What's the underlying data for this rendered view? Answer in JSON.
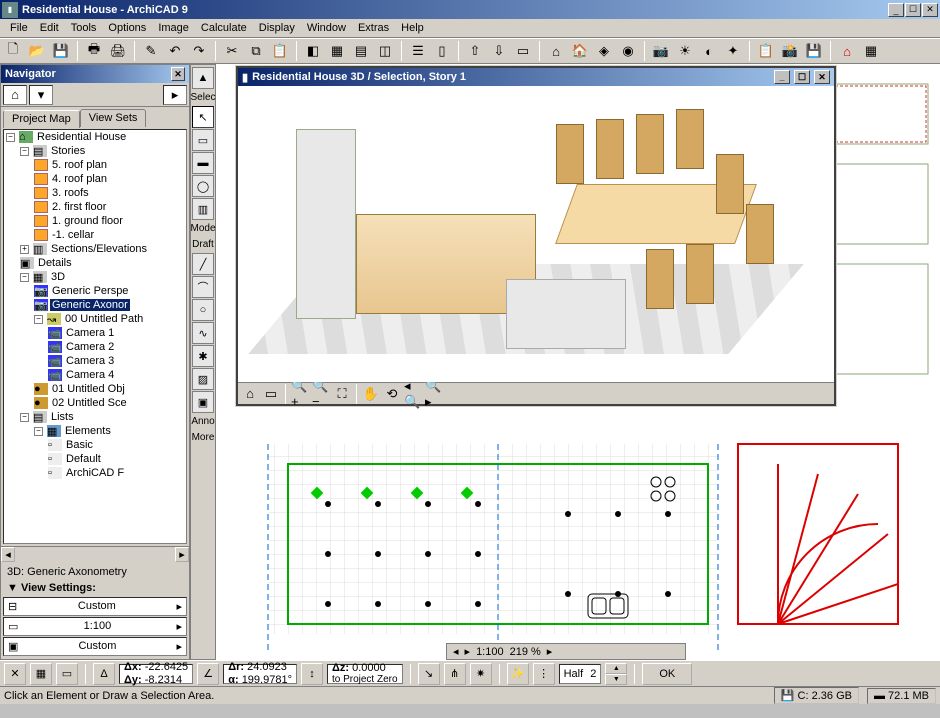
{
  "window": {
    "title": "Residential House - ArchiCAD 9",
    "min": "_",
    "max": "☐",
    "close": "✕"
  },
  "menu": [
    "File",
    "Edit",
    "Tools",
    "Options",
    "Image",
    "Calculate",
    "Display",
    "Window",
    "Extras",
    "Help"
  ],
  "navigator": {
    "title": "Navigator",
    "tabs": {
      "project_map": "Project Map",
      "view_sets": "View Sets"
    },
    "root": "Residential House",
    "stories_label": "Stories",
    "stories": [
      "5. roof plan",
      "4. roof plan",
      "3. roofs",
      "2. first floor",
      "1. ground floor",
      "-1. cellar"
    ],
    "sections": "Sections/Elevations",
    "details": "Details",
    "three_d": "3D",
    "persp": "Generic Perspe",
    "axon": "Generic Axonor",
    "path": "00 Untitled Path",
    "cams": [
      "Camera 1",
      "Camera 2",
      "Camera 3",
      "Camera 4"
    ],
    "obj1": "01 Untitled Obj",
    "obj2": "02 Untitled Sce",
    "lists": "Lists",
    "elements": "Elements",
    "el_items": [
      "Basic",
      "Default",
      "ArchiCAD F"
    ],
    "footer_3d": "3D: Generic Axonometry",
    "view_settings": "View Settings:",
    "custom": "Custom",
    "scale": "1:100",
    "custom2": "Custom"
  },
  "toolbox": {
    "select_hdr": "Selec",
    "mode": "Mode",
    "draft": "Draft",
    "anno": "Anno",
    "more": "More"
  },
  "inner3d": {
    "title": "Residential House 3D / Selection, Story 1"
  },
  "view2d": {
    "scale": "1:100",
    "zoom": "219 %"
  },
  "coords": {
    "dx_label": "Δx:",
    "dy_label": "Δy:",
    "dx": "-22.6425",
    "dy": "-8.2314",
    "dr_label": "Δr:",
    "a_label": "α:",
    "dr": "24.0923",
    "a": "199.9781°",
    "dz_label": "Δz:",
    "dz": "0.0000",
    "to_proj": "to Project Zero",
    "half": "Half",
    "half_n": "2",
    "ok": "OK"
  },
  "status": {
    "hint": "Click an Element or Draw a Selection Area.",
    "disk": "C: 2.36 GB",
    "mem": "72.1 MB"
  }
}
